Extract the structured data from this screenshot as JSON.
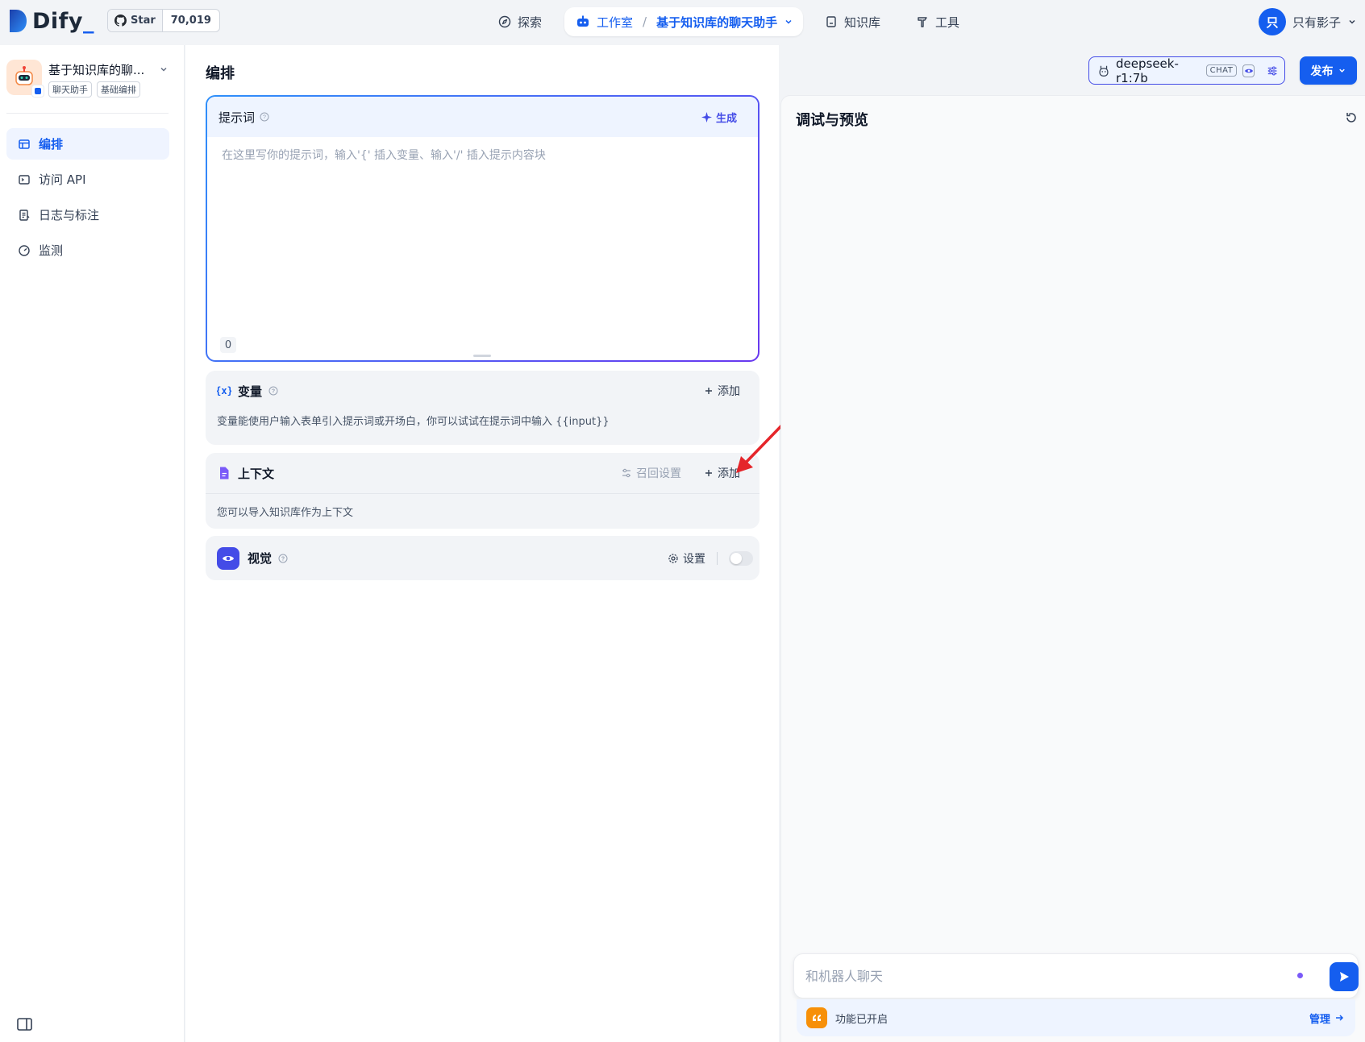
{
  "brand": {
    "name": "Dify",
    "suffix": "_"
  },
  "github": {
    "label": "Star",
    "count": "70,019"
  },
  "nav": {
    "explore": "探索",
    "studio": "工作室",
    "separator": "/",
    "current_app": "基于知识库的聊天助手",
    "knowledge": "知识库",
    "tools": "工具"
  },
  "user": {
    "avatar_initial": "只",
    "name": "只有影子"
  },
  "app": {
    "name": "基于知识库的聊...",
    "tags": [
      "聊天助手",
      "基础编排"
    ]
  },
  "sidebar": {
    "items": [
      {
        "label": "编排",
        "icon": "layout-icon",
        "active": true
      },
      {
        "label": "访问 API",
        "icon": "terminal-icon",
        "active": false
      },
      {
        "label": "日志与标注",
        "icon": "logs-icon",
        "active": false
      },
      {
        "label": "监测",
        "icon": "gauge-icon",
        "active": false
      }
    ]
  },
  "page": {
    "title": "编排"
  },
  "model": {
    "name": "deepseek-r1:7b",
    "mode_badge": "CHAT"
  },
  "publish": {
    "label": "发布"
  },
  "prompt": {
    "title": "提示词",
    "generate_label": "生成",
    "placeholder": "在这里写你的提示词，输入'{' 插入变量、输入'/' 插入提示内容块",
    "char_count": "0"
  },
  "variables": {
    "title": "变量",
    "add_label": "添加",
    "description": "变量能使用户输入表单引入提示词或开场白，你可以试试在提示词中输入 {{input}}"
  },
  "context": {
    "title": "上下文",
    "retrieval_label": "召回设置",
    "add_label": "添加",
    "description": "您可以导入知识库作为上下文"
  },
  "vision": {
    "title": "视觉",
    "settings_label": "设置",
    "enabled": false
  },
  "debug": {
    "title": "调试与预览",
    "input_placeholder": "和机器人聊天",
    "features_text": "功能已开启",
    "manage_label": "管理"
  },
  "colors": {
    "primary": "#155eef",
    "accent": "#444ce7",
    "annotation_arrow": "#e5252a"
  }
}
